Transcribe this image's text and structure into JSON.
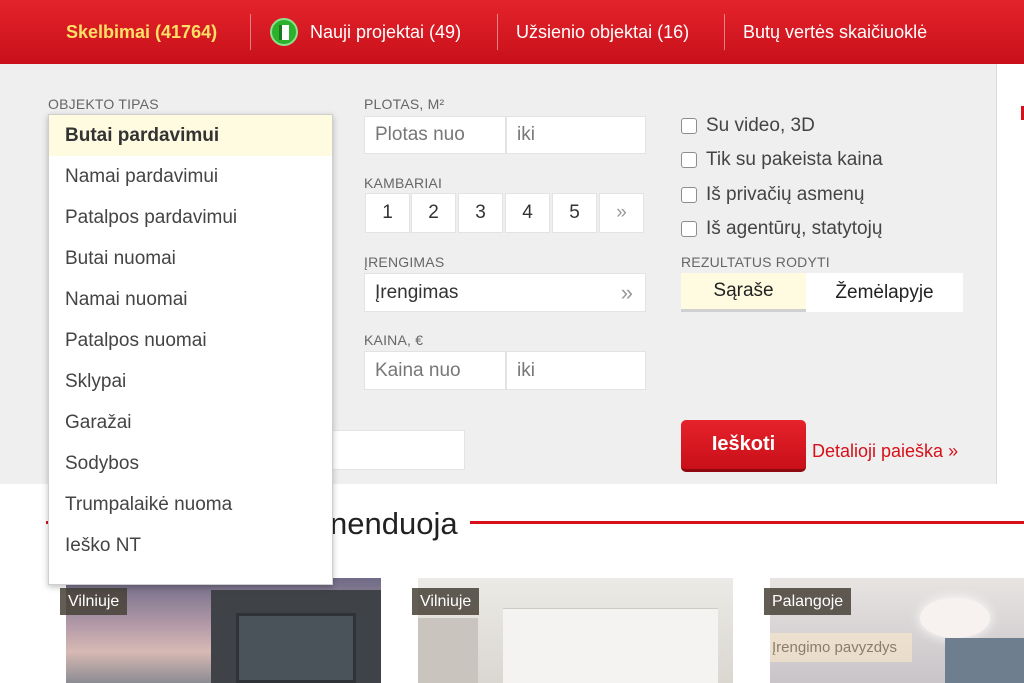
{
  "nav": {
    "items": [
      {
        "label": "Skelbimai (41764)"
      },
      {
        "label": "Nauji projektai (49)"
      },
      {
        "label": "Užsienio objektai (16)"
      },
      {
        "label": "Butų vertės skaičiuoklė"
      }
    ]
  },
  "search": {
    "object_type_label": "OBJEKTO TIPAS",
    "area_label": "PLOTAS, m²",
    "area_from_placeholder": "Plotas nuo",
    "area_to_placeholder": "iki",
    "rooms_label": "KAMBARIAI",
    "rooms": [
      "1",
      "2",
      "3",
      "4",
      "5",
      "»"
    ],
    "equipment_label": "ĮRENGIMAS",
    "equipment_value": "Įrengimas",
    "equipment_chevron": "»",
    "price_label": "KAINA, €",
    "price_from_placeholder": "Kaina nuo",
    "price_to_placeholder": "iki",
    "checkboxes": [
      "Su video, 3D",
      "Tik su pakeista kaina",
      "Iš privačių asmenų",
      "Iš agentūrų, statytojų"
    ],
    "results_label": "REZULTATUS RODYTI",
    "results_options": [
      "Sąraše",
      "Žemėlapyje"
    ],
    "search_button": "Ieškoti",
    "detail_link": "Detalioji paieška »"
  },
  "dropdown": {
    "items": [
      "Butai pardavimui",
      "Namai pardavimui",
      "Patalpos pardavimui",
      "Butai nuomai",
      "Namai nuomai",
      "Patalpos nuomai",
      "Sklypai",
      "Garažai",
      "Sodybos",
      "Trumpalaikė nuoma",
      "Ieško NT"
    ],
    "selected_index": 0
  },
  "recommend": {
    "title_partial": "nenduoja",
    "cards": [
      {
        "location": "Vilniuje"
      },
      {
        "location": "Vilniuje"
      },
      {
        "location": "Palangoje",
        "caption": "Įrengimo pavyzdys"
      }
    ]
  },
  "colors": {
    "brand_red": "#d7101a",
    "nav_active": "#ffe066",
    "selected_bg": "#fffbe0"
  }
}
